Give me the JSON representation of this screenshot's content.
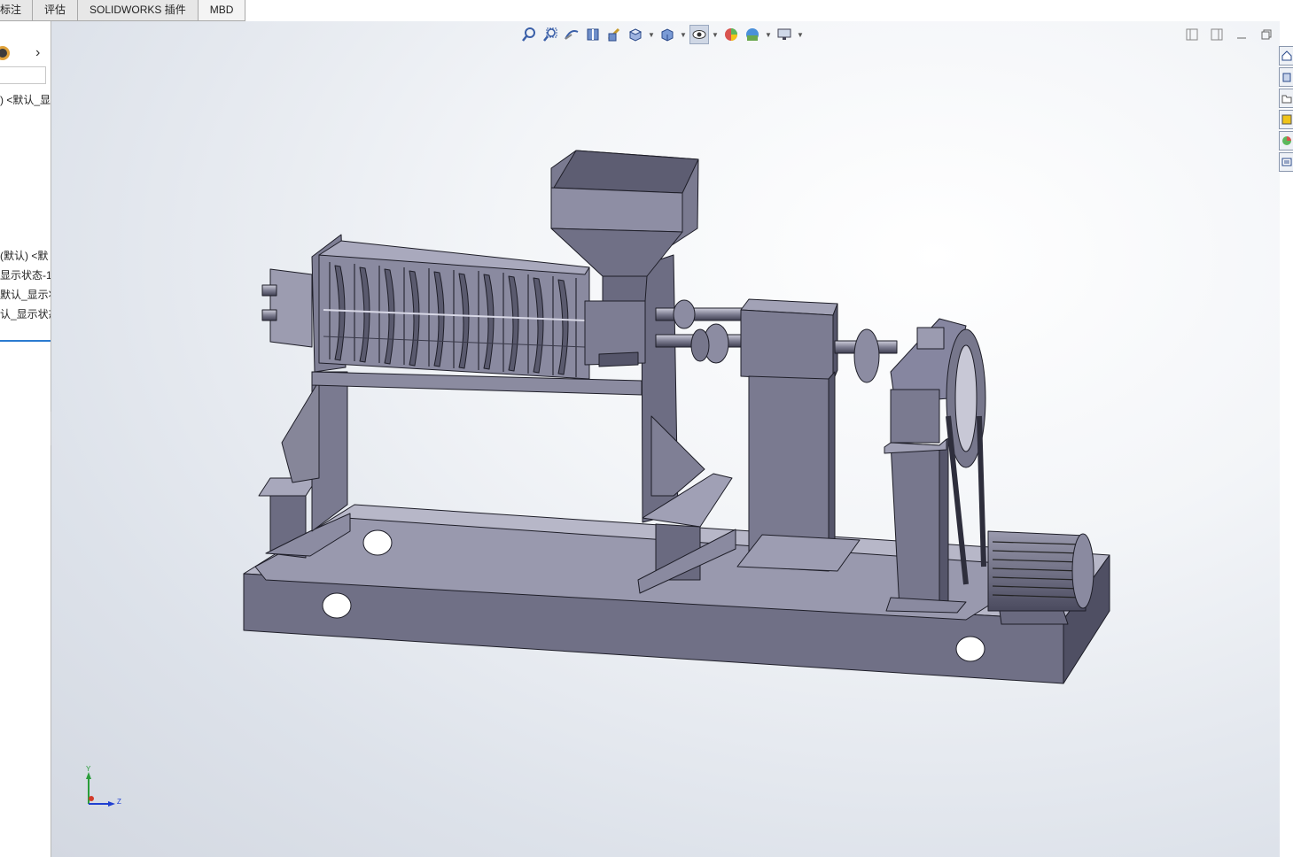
{
  "tabs": [
    "标注",
    "评估",
    "SOLIDWORKS 插件",
    "MBD"
  ],
  "tree": {
    "filter_placeholder": "",
    "rows": [
      ") <默认_显",
      "(默认) <默",
      "显示状态-1>",
      "默认_显示状",
      "认_显示状态"
    ]
  },
  "heads_up_toolbar": {
    "icons": [
      "zoom-to-fit-icon",
      "zoom-to-area-icon",
      "previous-view-icon",
      "section-view-icon",
      "dynamic-annotation-icon",
      "view-orientation-icon",
      "display-style-icon",
      "hide-show-items-icon",
      "edit-appearance-icon",
      "apply-scene-icon",
      "view-settings-icon"
    ]
  },
  "triad": {
    "y": "Y",
    "z": "Z"
  },
  "colors": {
    "part_fill": "#73738a",
    "part_dark": "#4e4e62",
    "part_light": "#9b9bb0",
    "edge": "#1e1e28",
    "accent": "#1f5fd1"
  }
}
